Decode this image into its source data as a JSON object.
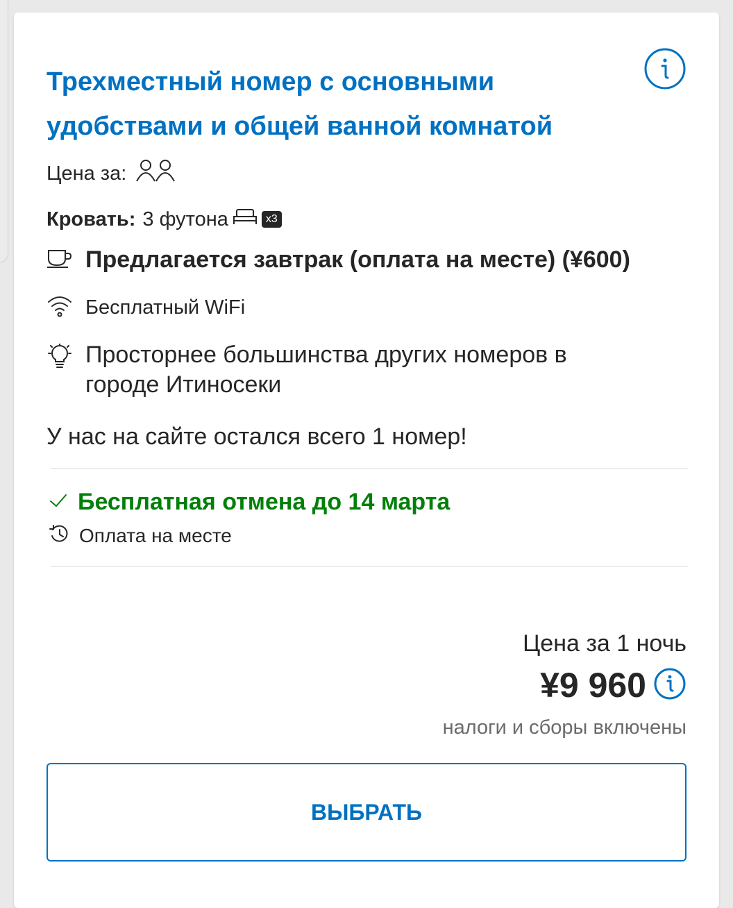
{
  "room": {
    "title": "Трехместный номер с основными удобствами и общей ванной комнатой",
    "price_for_label": "Цена за:",
    "bed_label": "Кровать:",
    "bed_value": "3 футона",
    "bed_count_badge": "x3"
  },
  "features": {
    "breakfast": "Предлагается завтрак (оплата на месте) (¥600)",
    "wifi": "Бесплатный WiFi",
    "spacious": "Просторнее большинства других номеров в городе Итиносеки"
  },
  "availability": "У нас на сайте остался всего 1 номер!",
  "policies": {
    "free_cancellation": "Бесплатная отмена до 14 марта",
    "pay_at_property": "Оплата на месте"
  },
  "pricing": {
    "per_night_label": "Цена за 1 ночь",
    "price": "¥9 960",
    "taxes_note": "налоги и сборы включены"
  },
  "actions": {
    "select_label": "ВЫБРАТЬ"
  },
  "icons": {
    "info": "info-icon",
    "guests": "two-persons-icon",
    "bed": "futon-bed-icon",
    "breakfast": "coffee-cup-icon",
    "wifi": "wifi-icon",
    "spacious": "lightbulb-icon",
    "cancel": "checkmark-icon",
    "pay": "history-clock-icon"
  },
  "colors": {
    "brand_blue": "#0071c2",
    "success_green": "#008009",
    "text": "#262626",
    "muted": "#6b6b6b"
  }
}
